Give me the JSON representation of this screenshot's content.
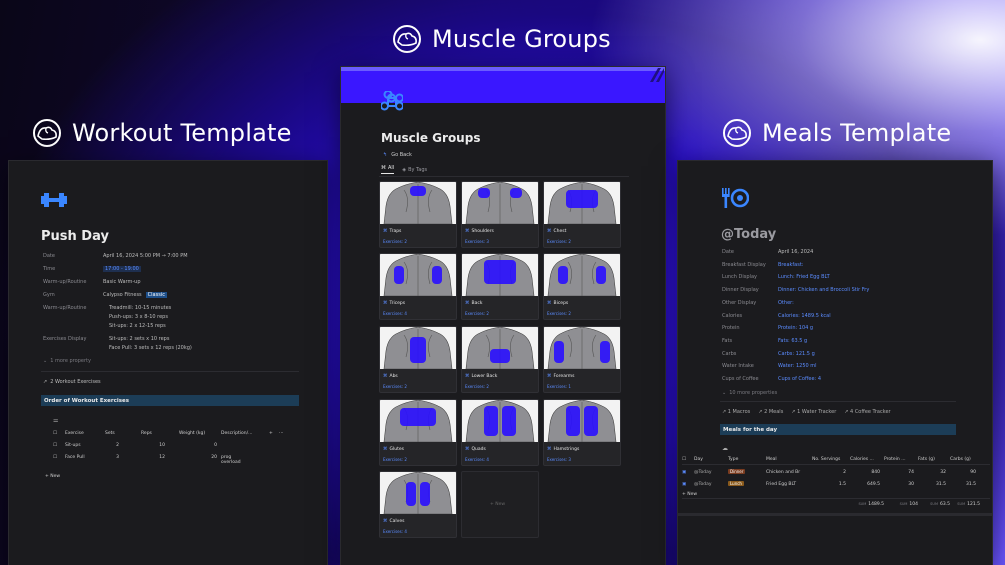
{
  "headings": {
    "workout": "Workout Template",
    "muscle": "Muscle Groups",
    "meals": "Meals Template"
  },
  "workout": {
    "title": "Push Day",
    "props": [
      {
        "label": "Date",
        "value": "April 16, 2024 5:00 PM → 7:00 PM"
      },
      {
        "label": "Time",
        "value": "17:00 - 19:00"
      },
      {
        "label": "Warm-up/Routine",
        "value": "Basic Warm-up"
      },
      {
        "label": "Gym",
        "value": "Calypso Fitness",
        "tag": "Classic"
      },
      {
        "label": "Warm-up/Routine",
        "lines": [
          "Treadmill: 10-15 minutes",
          "Push-ups: 3 x 8-10 reps",
          "Sit-ups: 2 x 12-15 reps"
        ]
      },
      {
        "label": "Exercises Display",
        "lines": [
          "Sit-ups: 2 sets x 10 reps",
          "Face Pull: 3 sets x 12 reps (20kg)"
        ]
      }
    ],
    "more": "1 more property",
    "relation": "2 Workout Exercises",
    "section": "Order of Workout Exercises",
    "table_headers": [
      "Exercise",
      "Sets",
      "Reps",
      "Weight (kg)",
      "Description/..."
    ],
    "rows": [
      {
        "name": "Sit-ups",
        "sets": "2",
        "reps": "10",
        "weight": "0",
        "desc": ""
      },
      {
        "name": "Face Pull",
        "sets": "3",
        "reps": "12",
        "weight": "20",
        "desc": "prog overload"
      }
    ],
    "new": "+ New"
  },
  "muscle": {
    "title": "Muscle Groups",
    "go_back": "Go Back",
    "tabs": [
      "All",
      "By Tags"
    ],
    "cards": [
      {
        "name": "Traps",
        "ex": "Exercises: 2"
      },
      {
        "name": "Shoulders",
        "ex": "Exercises: 3"
      },
      {
        "name": "Chest",
        "ex": "Exercises: 2"
      },
      {
        "name": "Triceps",
        "ex": "Exercises: 4"
      },
      {
        "name": "Back",
        "ex": "Exercises: 2"
      },
      {
        "name": "Biceps",
        "ex": "Exercises: 2"
      },
      {
        "name": "Abs",
        "ex": "Exercises: 2"
      },
      {
        "name": "Lower Back",
        "ex": "Exercises: 2"
      },
      {
        "name": "Forearms",
        "ex": "Exercises: 1"
      },
      {
        "name": "Glutes",
        "ex": "Exercises: 2"
      },
      {
        "name": "Quads",
        "ex": "Exercises: 4"
      },
      {
        "name": "Hamstrings",
        "ex": "Exercises: 3"
      },
      {
        "name": "Calves",
        "ex": "Exercises: 4"
      }
    ],
    "new": "+ New"
  },
  "meals": {
    "title": "@Today",
    "props": [
      {
        "label": "Date",
        "value": "April 16, 2024"
      },
      {
        "label": "Breakfast Display",
        "value": "Breakfast:"
      },
      {
        "label": "Lunch Display",
        "value": "Lunch: Fried Egg BLT"
      },
      {
        "label": "Dinner Display",
        "value": "Dinner: Chicken and Broccoli Stir Fry"
      },
      {
        "label": "Other Display",
        "value": "Other:"
      },
      {
        "label": "Calories",
        "value": "Calories: 1489.5 kcal"
      },
      {
        "label": "Protein",
        "value": "Protein: 104 g"
      },
      {
        "label": "Fats",
        "value": "Fats: 63.5 g"
      },
      {
        "label": "Carbs",
        "value": "Carbs: 121.5 g"
      },
      {
        "label": "Water Intake",
        "value": "Water: 1250 ml"
      },
      {
        "label": "Cups of Coffee",
        "value": "Cups of Coffee: 4"
      }
    ],
    "more": "10 more properties",
    "relations": [
      "1 Macros",
      "2 Meals",
      "1 Water Tracker",
      "4 Coffee Tracker"
    ],
    "section": "Meals for the day",
    "table_headers": [
      "Day",
      "Type",
      "Meal",
      "No. Servings",
      "Calories ...",
      "Protein ...",
      "Fats (g)",
      "Carbs (g)"
    ],
    "rows": [
      {
        "day": "@Today",
        "type": "Dinner",
        "meal": "Chicken and Br",
        "serv": "2",
        "cal": "840",
        "pro": "74",
        "fat": "32",
        "carb": "90"
      },
      {
        "day": "@Today",
        "type": "Lunch",
        "meal": "Fried Egg BLT",
        "serv": "1.5",
        "cal": "649.5",
        "pro": "30",
        "fat": "31.5",
        "carb": "31.5"
      }
    ],
    "new": "+ New",
    "totals": [
      {
        "label": "SUM",
        "value": "1489.5"
      },
      {
        "label": "SUM",
        "value": "104"
      },
      {
        "label": "SUM",
        "value": "63.5"
      },
      {
        "label": "SUM",
        "value": "121.5"
      }
    ]
  }
}
